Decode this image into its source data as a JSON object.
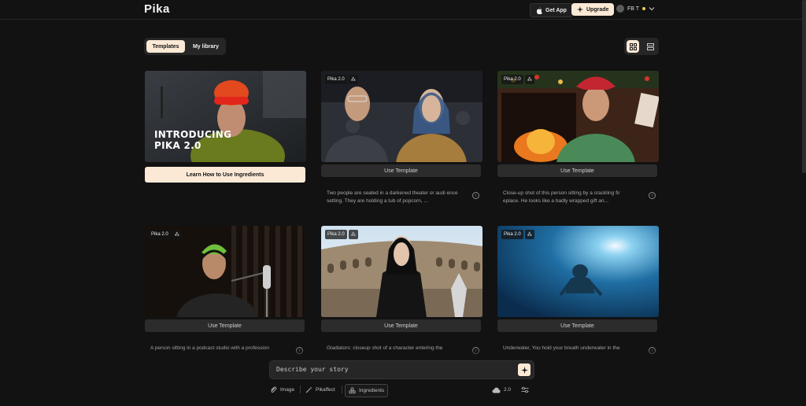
{
  "app": {
    "logo": "Pika"
  },
  "header": {
    "get_app": "Get App",
    "upgrade": "Upgrade",
    "user_name": "FB T"
  },
  "tabs": [
    {
      "label": "Templates",
      "active": true
    },
    {
      "label": "My library",
      "active": false
    }
  ],
  "featured": {
    "line1": "INTRODUCING",
    "line2": "PIKA 2.0",
    "button": "Learn How to Use Ingredients"
  },
  "cards": [
    {
      "badge": "Pika 2.0",
      "button": "Use Template",
      "description": "Two people are seated in a darkened theater or audi ence setting. They are holding a tub of popcorn, ..."
    },
    {
      "badge": "Pika 2.0",
      "button": "Use Template",
      "description": "Close-up shot of this person sitting by a crackling fir eplace. He looks like a badly wrapped gift an..."
    },
    {
      "badge": "Pika 2.0",
      "button": "Use Template",
      "description": "A person sitting in a podcast studio with a profession"
    },
    {
      "badge": "Pika 2.0",
      "button": "Use Template",
      "description": "Gladiators: closeup shot of a character entering the"
    },
    {
      "badge": "Pika 2.0",
      "button": "Use Template",
      "description": "Underwater, You hold your breath underwater in the"
    }
  ],
  "prompt": {
    "placeholder": "Describe your story"
  },
  "toolbar": {
    "image": "Image",
    "pikaffect": "Pikaffect",
    "ingredients": "Ingredients",
    "model": "2.0"
  },
  "colors": {
    "accent": "#fbe9d6",
    "background": "#121212",
    "surface": "#262626"
  }
}
